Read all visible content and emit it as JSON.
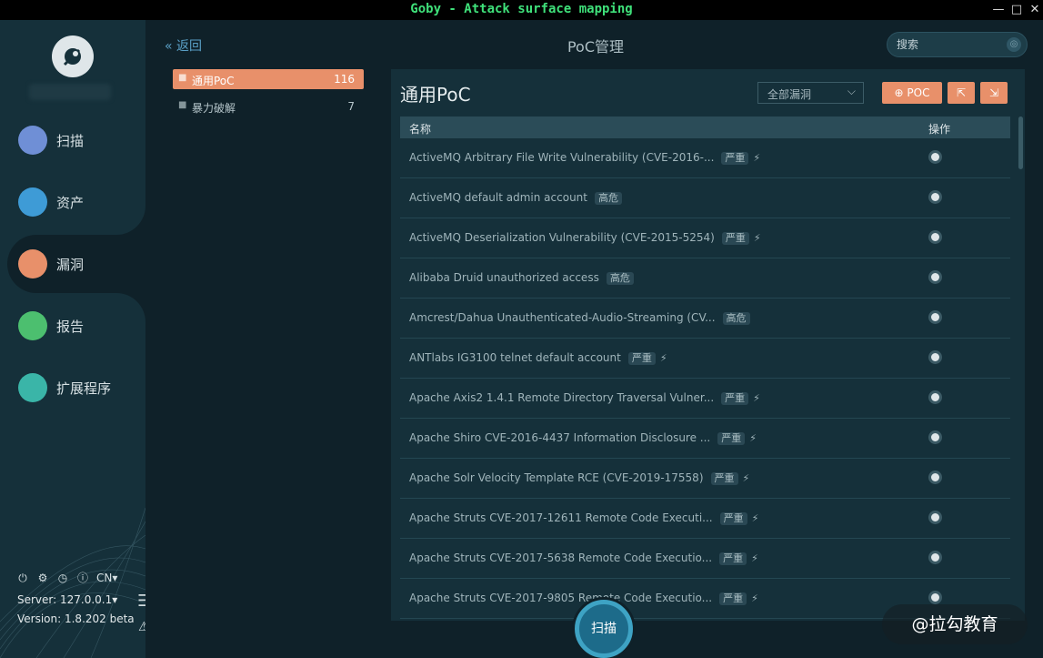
{
  "window": {
    "title": "Goby - Attack surface mapping"
  },
  "sidebar": {
    "nav": [
      {
        "label": "扫描",
        "color": "#6f8fd6"
      },
      {
        "label": "资产",
        "color": "#3e9bd6"
      },
      {
        "label": "漏洞",
        "color": "#e8906a"
      },
      {
        "label": "报告",
        "color": "#4cbf6f"
      },
      {
        "label": "扩展程序",
        "color": "#3ab5a8"
      }
    ],
    "lang": "CN",
    "server": "Server: 127.0.0.1",
    "version": "Version: 1.8.202 beta"
  },
  "header": {
    "back_label": "返回",
    "title": "PoC管理",
    "search_placeholder": "搜索"
  },
  "categories": [
    {
      "name": "通用PoC",
      "count": "116"
    },
    {
      "name": "暴力破解",
      "count": "7"
    }
  ],
  "panel": {
    "title": "通用PoC",
    "filter_value": "全部漏洞",
    "poc_button": "POC",
    "col_name": "名称",
    "col_action": "操作",
    "rows": [
      {
        "name": "ActiveMQ Arbitrary File Write Vulnerability (CVE-2016-...",
        "level": "严重",
        "bolt": true
      },
      {
        "name": "ActiveMQ default admin account",
        "level": "高危",
        "bolt": false
      },
      {
        "name": "ActiveMQ Deserialization Vulnerability (CVE-2015-5254)",
        "level": "严重",
        "bolt": true
      },
      {
        "name": "Alibaba Druid unauthorized access",
        "level": "高危",
        "bolt": false
      },
      {
        "name": "Amcrest/Dahua Unauthenticated-Audio-Streaming (CV...",
        "level": "高危",
        "bolt": false
      },
      {
        "name": "ANTlabs IG3100 telnet default account",
        "level": "严重",
        "bolt": true
      },
      {
        "name": "Apache Axis2 1.4.1 Remote Directory Traversal Vulner...",
        "level": "严重",
        "bolt": true
      },
      {
        "name": "Apache Shiro CVE-2016-4437 Information Disclosure ...",
        "level": "严重",
        "bolt": true
      },
      {
        "name": "Apache Solr Velocity Template RCE (CVE-2019-17558)",
        "level": "严重",
        "bolt": true
      },
      {
        "name": "Apache Struts CVE-2017-12611 Remote Code Executi...",
        "level": "严重",
        "bolt": true
      },
      {
        "name": "Apache Struts CVE-2017-5638 Remote Code Executio...",
        "level": "严重",
        "bolt": true
      },
      {
        "name": "Apache Struts CVE-2017-9805 Remote Code Executio...",
        "level": "严重",
        "bolt": true
      }
    ]
  },
  "scan_button": "扫描",
  "watermark": "@拉勾教育"
}
